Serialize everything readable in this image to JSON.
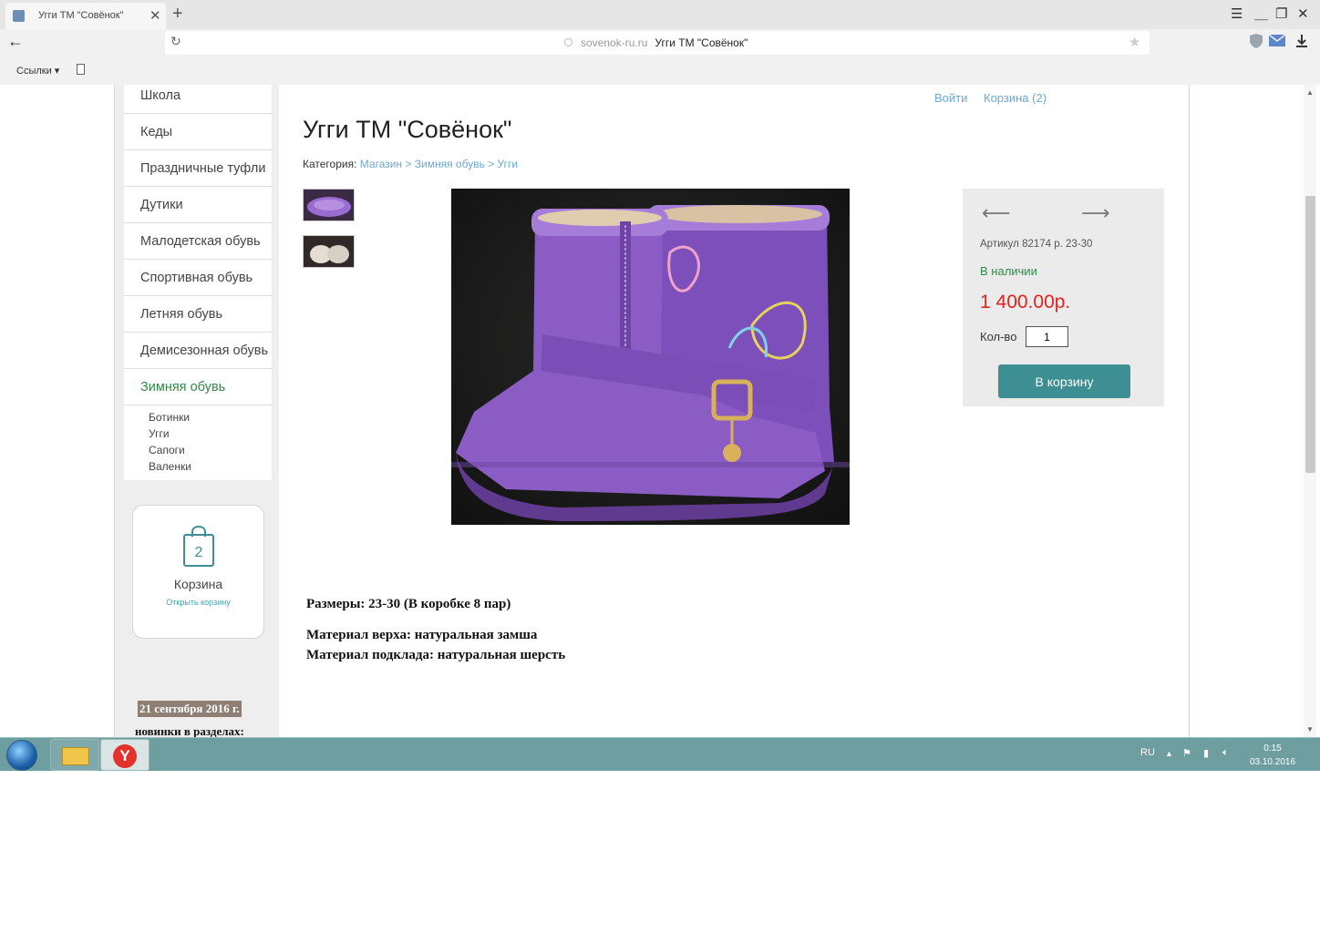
{
  "browser": {
    "tab_title": "Угги ТМ \"Совёнок\"",
    "tab_close": "✕",
    "new_tab": "+",
    "address": {
      "domain": "sovenok-ru.ru",
      "page_title": "Угги ТМ \"Совёнок\""
    },
    "bookmarks_label": "Ссылки ▾"
  },
  "sidebar": {
    "menu": [
      {
        "label": "Школа"
      },
      {
        "label": "Кеды"
      },
      {
        "label": "Праздничные туфли"
      },
      {
        "label": "Дутики"
      },
      {
        "label": "Малодетская обувь"
      },
      {
        "label": "Спортивная обувь"
      },
      {
        "label": "Летняя обувь"
      },
      {
        "label": "Демисезонная обувь"
      },
      {
        "label": "Зимняя обувь"
      }
    ],
    "submenu": [
      "Ботинки",
      "Угги",
      "Сапоги",
      "Валенки"
    ],
    "cart": {
      "count": "2",
      "title": "Корзина",
      "open_link": "Открыть корзину"
    },
    "news": {
      "date": "21 сентября 2016 г.",
      "text": "новинки в разделах:"
    }
  },
  "header": {
    "login": "Войти",
    "cart_link": "Корзина (2)"
  },
  "product": {
    "title": "Угги ТМ \"Совёнок\"",
    "category_label": "Категория:",
    "breadcrumbs": [
      "Магазин",
      "Зимняя обувь",
      "Угги"
    ],
    "breadcrumb_sep": " > ",
    "sku": "Артикул 82174 р. 23-30",
    "stock": "В наличии",
    "price": "1 400.00р.",
    "qty_label": "Кол-во",
    "qty_value": "1",
    "buy_button": "В корзину",
    "description": [
      "Размеры: 23-30 (В коробке 8 пар)",
      "Материал верха: натуральная замша",
      "Материал подклада: натуральная шерсть"
    ]
  },
  "taskbar": {
    "language": "RU",
    "time": "0:15",
    "date": "03.10.2016"
  },
  "colors": {
    "accent_teal": "#3d8f94",
    "link_blue": "#6ba7d6",
    "price_red": "#e3221d",
    "stock_green": "#2f8a46",
    "boot_purple": "#8a5cc4"
  }
}
